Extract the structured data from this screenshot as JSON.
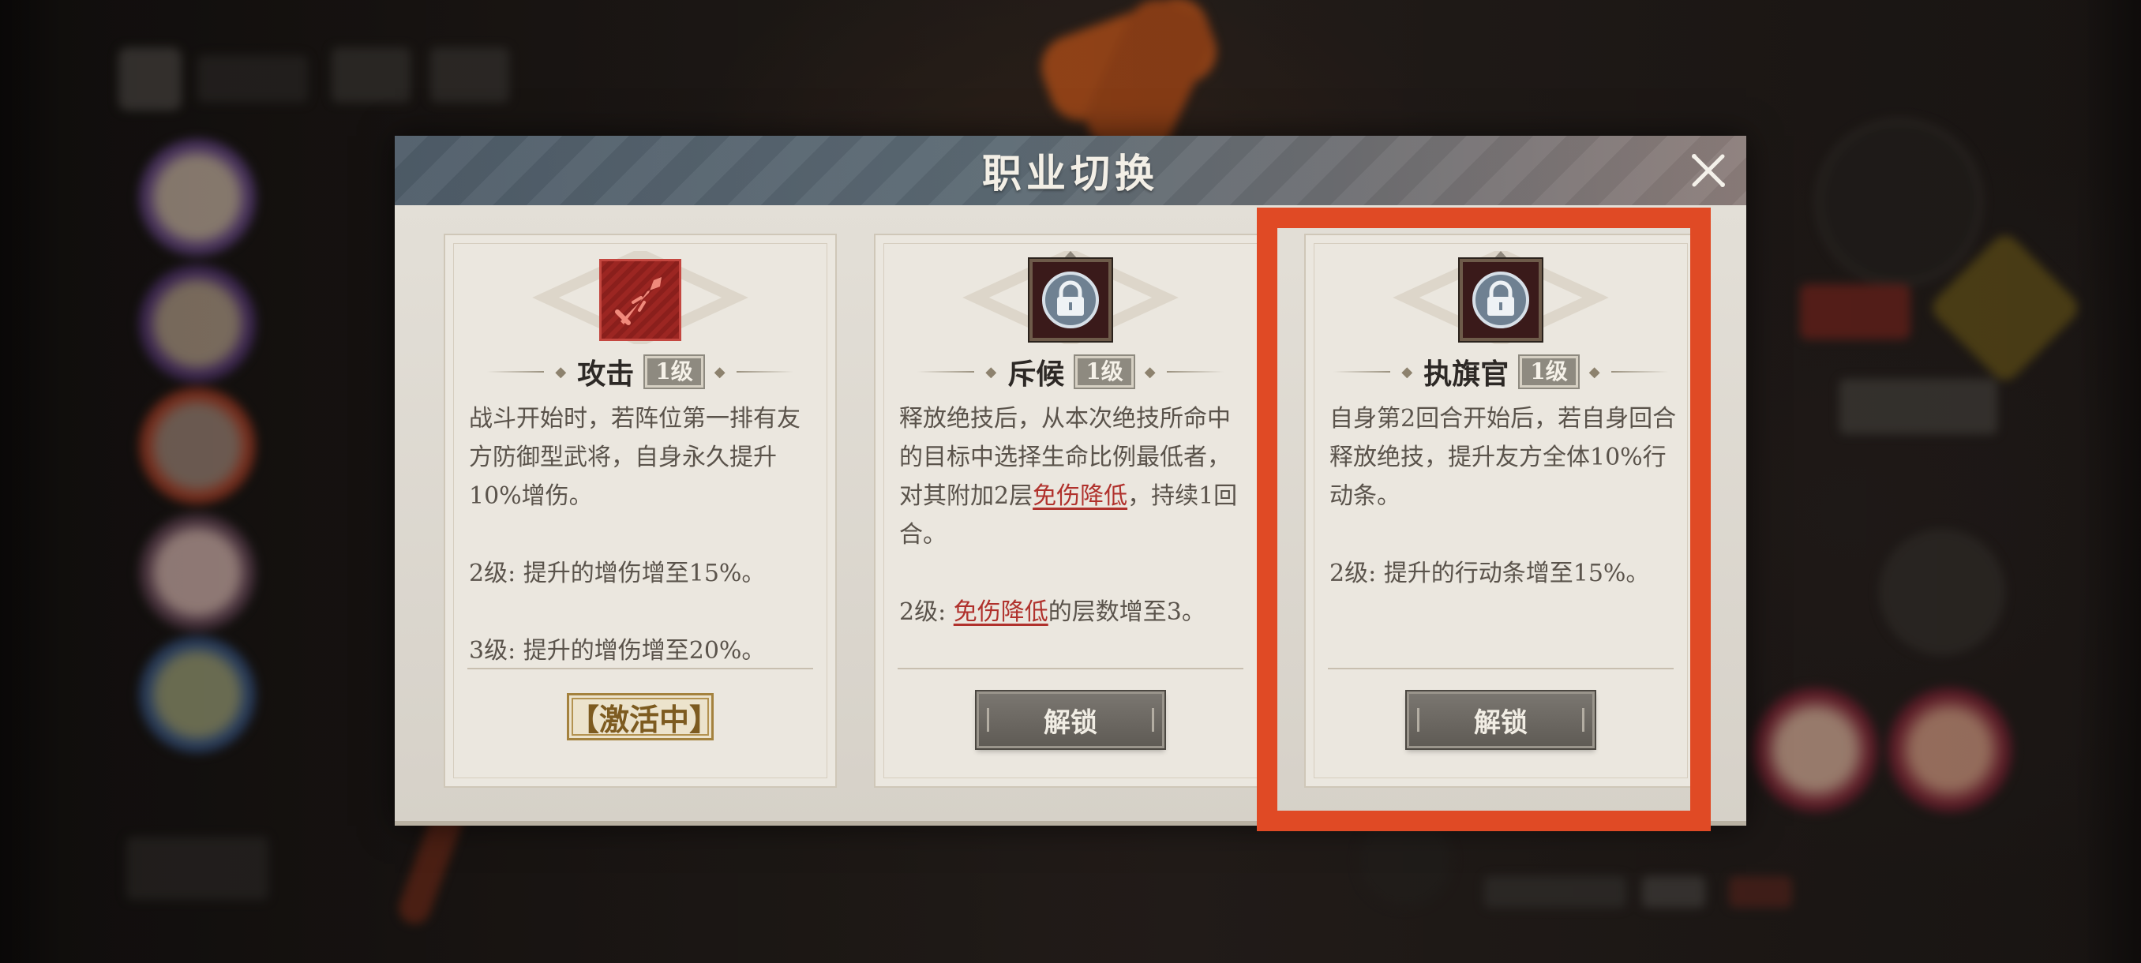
{
  "dialog": {
    "title": "职业切换",
    "close_icon": "close-icon"
  },
  "cards": [
    {
      "name": "攻击",
      "level": "1级",
      "icon": "sword-icon",
      "desc": [
        "战斗开始时，若阵位第一排有友方防御型武将，自身永久提升10%增伤。",
        "2级: 提升的增伤增至15%。",
        "3级: 提升的增伤增至20%。"
      ],
      "status_label": "【激活中】"
    },
    {
      "name": "斥候",
      "level": "1级",
      "icon": "lock-icon",
      "desc1_a": "释放绝技后，从本次绝技所命中的目标中选择生命比例最低者，对其附加2层",
      "desc1_kw": "免伤降低",
      "desc1_b": "，持续1回合。",
      "desc2_a": "2级: ",
      "desc2_kw": "免伤降低",
      "desc2_b": "的层数增至3。",
      "button_label": "解锁"
    },
    {
      "name": "执旗官",
      "level": "1级",
      "icon": "lock-icon",
      "desc": [
        "自身第2回合开始后，若自身回合释放绝技，提升友方全体10%行动条。",
        "2级: 提升的行动条增至15%。"
      ],
      "button_label": "解锁"
    }
  ],
  "colors": {
    "highlight": "#e04a25",
    "keyword": "#b0312c",
    "header": "#5c6a74"
  }
}
